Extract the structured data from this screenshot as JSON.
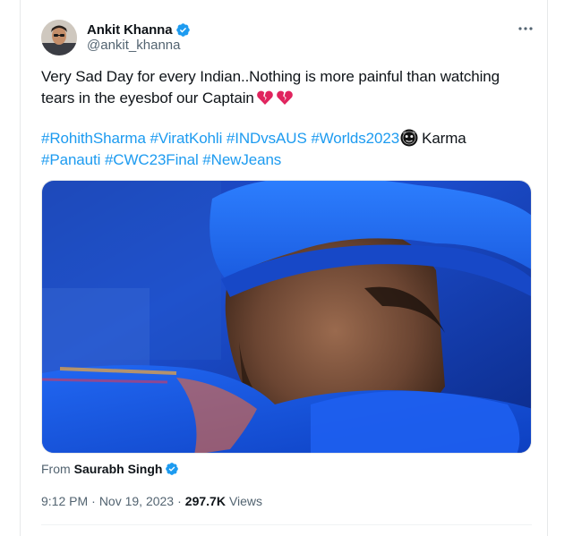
{
  "author": {
    "display_name": "Ankit Khanna",
    "handle": "@ankit_khanna",
    "verified": true
  },
  "tweet": {
    "text_line_1": "Very Sad Day for every Indian..Nothing is more painful than watching",
    "text_line_2": "tears in the eyesbof our Captain",
    "emojis": [
      "broken-heart-icon",
      "broken-heart-icon"
    ],
    "hashtags_line_1": [
      "#RohithSharma",
      "#ViratKohli",
      "#INDvsAUS",
      "#Worlds2023"
    ],
    "after_emoji_text": "Karma",
    "hashtags_line_2": [
      "#Panauti",
      "#CWC23Final",
      "#NewJeans"
    ]
  },
  "media": {
    "from_label": "From",
    "from_name": "Saurabh Singh",
    "from_verified": true
  },
  "meta": {
    "time": "9:12 PM",
    "separator": "·",
    "date": "Nov 19, 2023",
    "views_count": "297.7K",
    "views_label": "Views"
  },
  "colors": {
    "link": "#1d9bf0",
    "text": "#0f1419",
    "secondary": "#536471",
    "verified": "#1d9bf0",
    "heart": "#e0245e"
  }
}
